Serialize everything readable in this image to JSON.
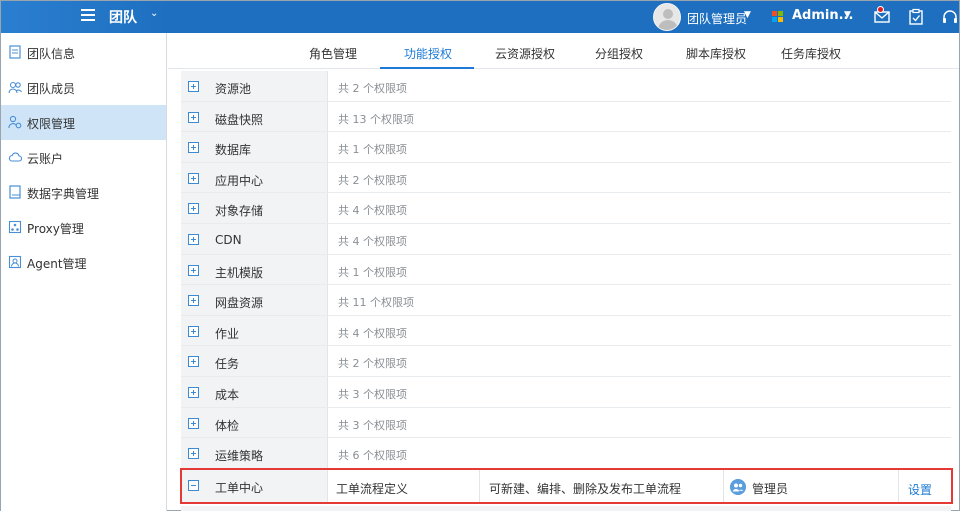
{
  "header": {
    "team_title": "团队",
    "user_name": "团队管理员",
    "account_name": "Admin...",
    "colors": {
      "bar": "#1e6fc0",
      "accent": "#1e7ad6",
      "highlight": "#e53935"
    }
  },
  "sidebar": {
    "items": [
      {
        "label": "团队信息",
        "icon": "document-icon"
      },
      {
        "label": "团队成员",
        "icon": "users-icon"
      },
      {
        "label": "权限管理",
        "icon": "user-permission-icon"
      },
      {
        "label": "云账户",
        "icon": "cloud-icon"
      },
      {
        "label": "数据字典管理",
        "icon": "dictionary-icon"
      },
      {
        "label": "Proxy管理",
        "icon": "proxy-icon"
      },
      {
        "label": "Agent管理",
        "icon": "agent-icon"
      }
    ]
  },
  "tabs": [
    {
      "label": "角色管理"
    },
    {
      "label": "功能授权"
    },
    {
      "label": "云资源授权"
    },
    {
      "label": "分组授权"
    },
    {
      "label": "脚本库授权"
    },
    {
      "label": "任务库授权"
    }
  ],
  "permissions": [
    {
      "name": "资源池",
      "count": "共 2 个权限项"
    },
    {
      "name": "磁盘快照",
      "count": "共 13 个权限项"
    },
    {
      "name": "数据库",
      "count": "共 1 个权限项"
    },
    {
      "name": "应用中心",
      "count": "共 2 个权限项"
    },
    {
      "name": "对象存储",
      "count": "共 4 个权限项"
    },
    {
      "name": "CDN",
      "count": "共 4 个权限项"
    },
    {
      "name": "主机模版",
      "count": "共 1 个权限项"
    },
    {
      "name": "网盘资源",
      "count": "共 11 个权限项"
    },
    {
      "name": "作业",
      "count": "共 4 个权限项"
    },
    {
      "name": "任务",
      "count": "共 2 个权限项"
    },
    {
      "name": "成本",
      "count": "共 3 个权限项"
    },
    {
      "name": "体检",
      "count": "共 3 个权限项"
    },
    {
      "name": "运维策略",
      "count": "共 6 个权限项"
    }
  ],
  "expanded": {
    "name": "工单中心",
    "item_name": "工单流程定义",
    "item_desc": "可新建、编排、删除及发布工单流程",
    "role": "管理员",
    "action": "设置"
  }
}
